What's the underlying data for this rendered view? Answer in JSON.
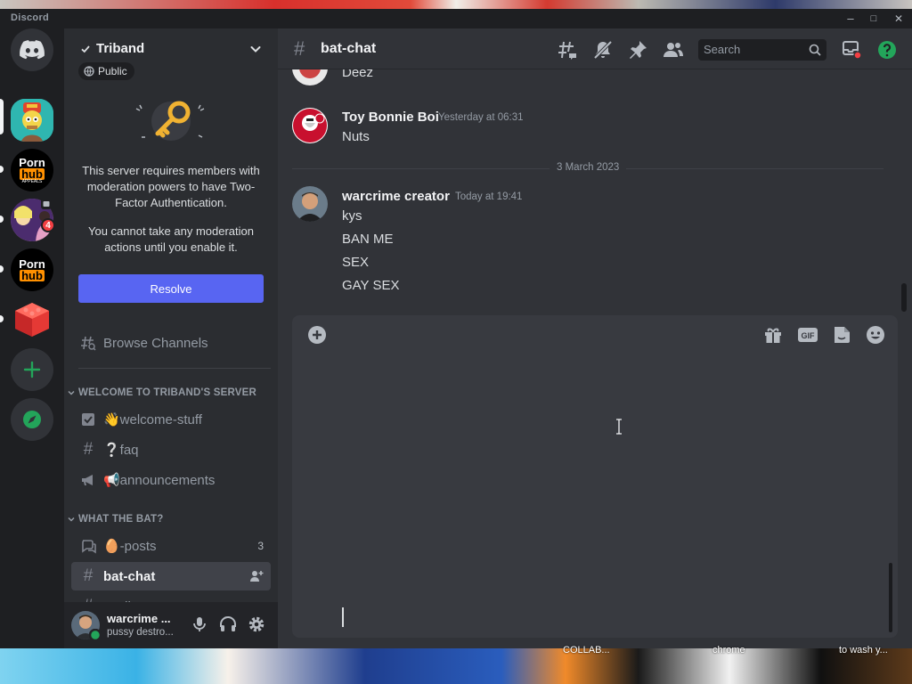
{
  "app": {
    "title": "Discord"
  },
  "window_controls": {
    "minimize": "–",
    "maximize": "□",
    "close": "✕"
  },
  "guilds": {
    "icons": [
      "discord-home-icon",
      "add-server-icon",
      "explore-icon"
    ],
    "ph_top": "Porn",
    "ph_box": "hub",
    "ph_sub": "APPEALS",
    "badge": "4"
  },
  "server": {
    "name": "Triband",
    "public_label": "Public",
    "notice_line1": "This server requires members with moderation powers to have Two-Factor Authentication.",
    "notice_line2": "You cannot take any moderation actions until you enable it.",
    "resolve_label": "Resolve",
    "browse_channels": "Browse Channels"
  },
  "categories": [
    {
      "name": "WELCOME TO TRIBAND'S SERVER"
    },
    {
      "name": "WHAT THE BAT?"
    }
  ],
  "channels": [
    {
      "name": "👋welcome-stuff",
      "icon": "rules-checkbox-icon"
    },
    {
      "name": "❔faq",
      "icon": "hash-icon"
    },
    {
      "name": "📢announcements",
      "icon": "megaphone-icon"
    },
    {
      "name": "🥚-posts",
      "icon": "forum-icon",
      "count": "3"
    },
    {
      "name": "bat-chat",
      "icon": "hash-icon",
      "active": true
    },
    {
      "name": "spoilers",
      "icon": "hash-icon"
    }
  ],
  "user": {
    "name": "warcrime ...",
    "status": "pussy destro..."
  },
  "header": {
    "channel": "bat-chat",
    "search_placeholder": "Search"
  },
  "messages": [
    {
      "author": "",
      "lines": [
        "Deez"
      ]
    },
    {
      "author": "Toy Bonnie Boi",
      "time": "Yesterday at 06:31",
      "lines": [
        "Nuts"
      ]
    },
    {
      "divider": "3 March 2023"
    },
    {
      "author": "warcrime creator",
      "time": "Today at 19:41",
      "lines": [
        "kys",
        "BAN ME",
        "SEX",
        "GAY SEX"
      ]
    }
  ],
  "composer": {
    "value": ""
  },
  "taskbar": [
    "COLLAB...",
    "chrome",
    "to wash y..."
  ],
  "colors": {
    "blurple": "#5865f2",
    "online": "#23a55a",
    "danger": "#f23f43"
  }
}
